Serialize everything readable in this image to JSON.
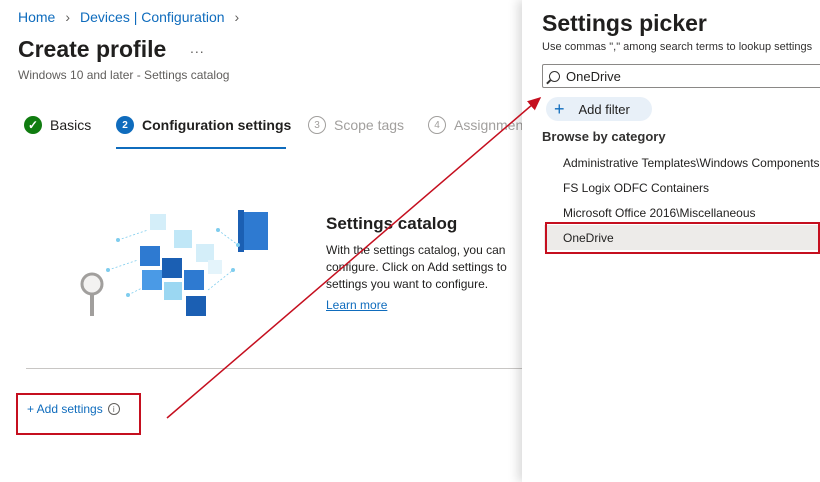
{
  "breadcrumb": {
    "home": "Home",
    "devices": "Devices | Configuration"
  },
  "page": {
    "title": "Create profile",
    "more": "...",
    "subtitle": "Windows 10 and later - Settings catalog"
  },
  "steps": [
    {
      "number": "✓",
      "label": "Basics",
      "state": "done"
    },
    {
      "number": "2",
      "label": "Configuration settings",
      "state": "active"
    },
    {
      "number": "3",
      "label": "Scope tags",
      "state": "pending"
    },
    {
      "number": "4",
      "label": "Assignments",
      "state": "pending"
    }
  ],
  "catalog": {
    "title": "Settings catalog",
    "desc_line1": "With the settings catalog, you can",
    "desc_line2": "configure. Click on Add settings to",
    "desc_line3": "settings you want to configure.",
    "learn_more": "Learn more"
  },
  "add_settings": {
    "label": "+ Add settings",
    "info": "i"
  },
  "picker": {
    "title": "Settings picker",
    "description": "Use commas \",\" among search terms to lookup settings",
    "search_value": "OneDrive",
    "add_filter": "Add filter",
    "browse_label": "Browse by category",
    "categories": [
      {
        "label": "Administrative Templates\\Windows Components"
      },
      {
        "label": "FS Logix ODFC Containers"
      },
      {
        "label": "Microsoft Office 2016\\Miscellaneous"
      },
      {
        "label": "OneDrive"
      }
    ]
  },
  "colors": {
    "accent": "#0f6cbd",
    "success": "#107c10",
    "annotation_red": "#c50f1f"
  }
}
